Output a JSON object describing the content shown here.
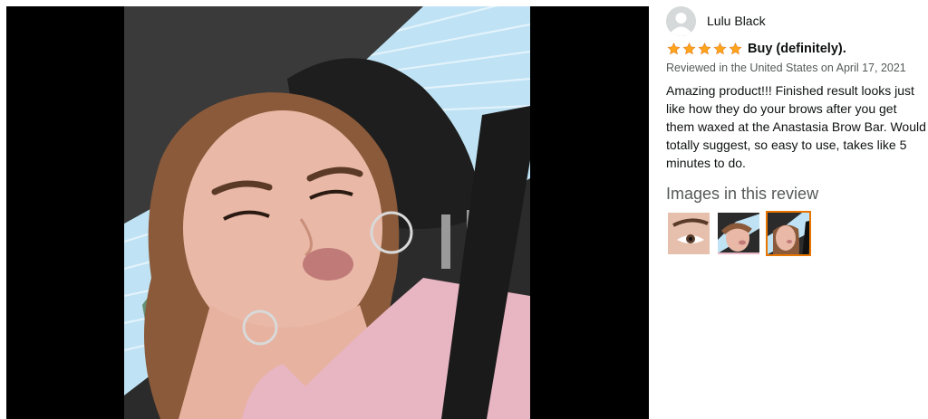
{
  "review": {
    "author_name": "Lulu Black",
    "rating": 5,
    "title": "Buy (definitely).",
    "meta": "Reviewed in the United States on April 17, 2021",
    "body": "Amazing product!!! Finished result looks just like how they do your brows after you get them waxed at the Anastasia Brow Bar. Would totally suggest, so easy to use, takes like 5 minutes to do."
  },
  "images_section": {
    "heading": "Images in this review",
    "thumbnails": [
      {
        "name": "thumbnail-eye",
        "selected": false
      },
      {
        "name": "thumbnail-selfie-1",
        "selected": false
      },
      {
        "name": "thumbnail-selfie-2",
        "selected": true
      }
    ]
  },
  "colors": {
    "star": "#ffa41c",
    "selected_border": "#e77600",
    "viewer_bg": "#000000"
  },
  "icons": {
    "avatar": "default-avatar-icon",
    "star": "star-icon"
  }
}
